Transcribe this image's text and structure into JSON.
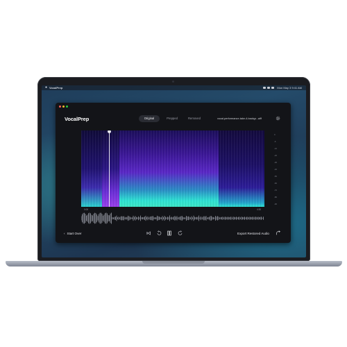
{
  "os": {
    "menu_app_name": "VocalPrep",
    "clock": "Mon May 3 9:41 AM"
  },
  "app": {
    "logo": "VocalPrep",
    "tabs": [
      {
        "label": "Original",
        "active": true
      },
      {
        "label": "Prepped",
        "active": false
      },
      {
        "label": "Removed",
        "active": false
      }
    ],
    "filename": "vocal-performance-take-4-backgr...aiff",
    "spectrogram": {
      "db_ticks": [
        "0",
        "-5",
        "-10",
        "-20",
        "-30",
        "-40",
        "-50",
        "-60",
        "-70",
        "-80",
        "-90"
      ],
      "time_start": "0:00",
      "time_end": "4:30"
    },
    "footer": {
      "start_over_label": "Start Over",
      "export_label": "Export Restored Audio"
    }
  },
  "colors": {
    "accent_cyan": "#2ee6d6",
    "accent_purple": "#7b2ff7",
    "window_bg": "#131418"
  },
  "icons": [
    "apple-icon",
    "settings-gear-icon",
    "skip-back-icon",
    "rewind-icon",
    "pause-icon",
    "forward-icon",
    "share-icon",
    "chevron-left-icon"
  ]
}
